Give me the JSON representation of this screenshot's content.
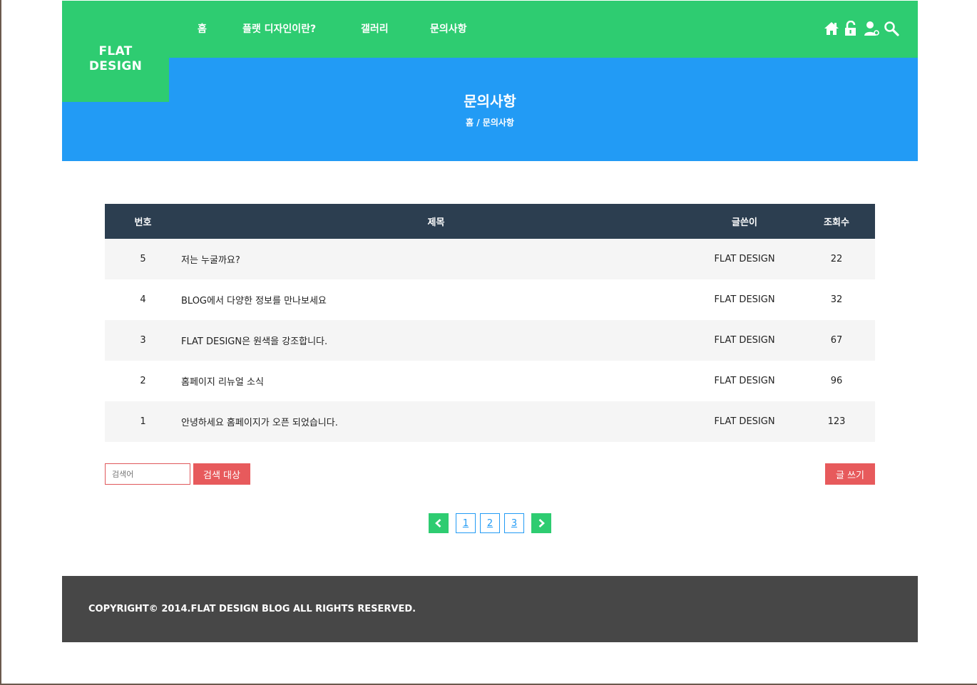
{
  "logo": {
    "line1": "FLAT",
    "line2": "DESIGN"
  },
  "nav": {
    "items": [
      {
        "label": "홈"
      },
      {
        "label": "플랫 디자인이란?"
      },
      {
        "label": "갤러리"
      },
      {
        "label": "문의사항"
      }
    ]
  },
  "util_icons": [
    "home-icon",
    "lock-icon",
    "user-icon",
    "search-icon"
  ],
  "visual": {
    "title": "문의사항",
    "breadcrumb": "홈 / 문의사항"
  },
  "board": {
    "headers": {
      "num": "번호",
      "title": "제목",
      "writer": "글쓴이",
      "views": "조회수"
    },
    "rows": [
      {
        "num": "5",
        "title": "저는 누굴까요?",
        "writer": "FLAT DESIGN",
        "views": "22"
      },
      {
        "num": "4",
        "title": "BLOG에서 다양한 정보를 만나보세요",
        "writer": "FLAT DESIGN",
        "views": "32"
      },
      {
        "num": "3",
        "title": "FLAT DESIGN은 원색을 강조합니다.",
        "writer": "FLAT DESIGN",
        "views": "67"
      },
      {
        "num": "2",
        "title": "홈페이지 리뉴얼 소식",
        "writer": "FLAT DESIGN",
        "views": "96"
      },
      {
        "num": "1",
        "title": "안녕하세요 홈페이지가 오픈 되었습니다.",
        "writer": "FLAT DESIGN",
        "views": "123"
      }
    ]
  },
  "search": {
    "placeholder": "검색어",
    "button_label": "검색 대상"
  },
  "write_button_label": "글 쓰기",
  "paging": {
    "pages": [
      "1",
      "2",
      "3"
    ]
  },
  "footer": {
    "copyright": "COPYRIGHT© 2014.FLAT DESIGN BLOG ALL RIGHTS RESERVED."
  },
  "colors": {
    "green": "#2ecc71",
    "blue": "#229bf5",
    "navy": "#2c3e50",
    "red": "#e75a5c",
    "footer": "#474747"
  }
}
